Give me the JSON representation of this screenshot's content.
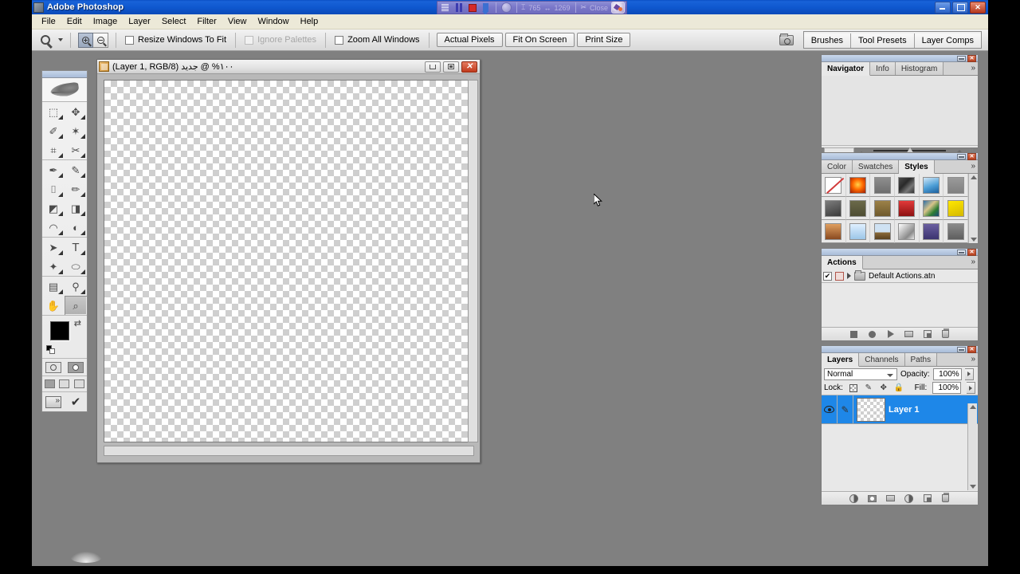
{
  "app": {
    "title": "Adobe Photoshop",
    "window_buttons": [
      {
        "name": "minimize",
        "glyph": "min"
      },
      {
        "name": "maximize",
        "glyph": "max"
      },
      {
        "name": "close",
        "glyph": "✕"
      }
    ]
  },
  "recorder": {
    "menu_icon": "menu-lines-icon",
    "pause_label": "pause",
    "stop_label": "stop",
    "save_label": "save",
    "globe_label": "globe",
    "time_value": "765",
    "size_value": "1269",
    "close_label": "Close",
    "logo_label": "recorder-logo",
    "bg_color": "#7a78c9"
  },
  "menubar": {
    "items": [
      {
        "label": "File"
      },
      {
        "label": "Edit"
      },
      {
        "label": "Image"
      },
      {
        "label": "Layer"
      },
      {
        "label": "Select"
      },
      {
        "label": "Filter"
      },
      {
        "label": "View"
      },
      {
        "label": "Window"
      },
      {
        "label": "Help"
      }
    ]
  },
  "optionsbar": {
    "tool_icon": "zoom-tool-icon",
    "zoom_in_label": "Zoom In",
    "zoom_out_label": "Zoom Out",
    "checkboxes": [
      {
        "label": "Resize Windows To Fit",
        "checked": false,
        "disabled": false
      },
      {
        "label": "Ignore Palettes",
        "checked": false,
        "disabled": true
      },
      {
        "label": "Zoom All Windows",
        "checked": false,
        "disabled": false
      }
    ],
    "buttons": [
      {
        "label": "Actual Pixels"
      },
      {
        "label": "Fit On Screen"
      },
      {
        "label": "Print Size"
      }
    ],
    "palette_well": {
      "icon": "file-browser-icon",
      "tabs": [
        {
          "label": "Brushes"
        },
        {
          "label": "Tool Presets"
        },
        {
          "label": "Layer Comps"
        }
      ]
    }
  },
  "toolbox": {
    "logo": "photoshop-feather-logo",
    "groups": [
      [
        {
          "name": "marquee-tool",
          "glyph": "⬚"
        },
        {
          "name": "move-tool",
          "glyph": "✥"
        },
        {
          "name": "lasso-tool",
          "glyph": "✑"
        },
        {
          "name": "magic-wand-tool",
          "glyph": "✶"
        },
        {
          "name": "crop-tool",
          "glyph": "⌗"
        },
        {
          "name": "slice-tool",
          "glyph": "✂"
        }
      ],
      [
        {
          "name": "healing-brush-tool",
          "glyph": "✒"
        },
        {
          "name": "brush-tool",
          "glyph": "🖌"
        },
        {
          "name": "clone-stamp-tool",
          "glyph": "⌷"
        },
        {
          "name": "history-brush-tool",
          "glyph": "✎"
        },
        {
          "name": "eraser-tool",
          "glyph": "◩"
        },
        {
          "name": "gradient-tool",
          "glyph": "◨"
        },
        {
          "name": "blur-tool",
          "glyph": "◠"
        },
        {
          "name": "dodge-tool",
          "glyph": "◐"
        }
      ],
      [
        {
          "name": "path-selection-tool",
          "glyph": "➤"
        },
        {
          "name": "type-tool",
          "glyph": "T"
        },
        {
          "name": "pen-tool",
          "glyph": "✦"
        },
        {
          "name": "ellipse-shape-tool",
          "glyph": "⬭"
        }
      ],
      [
        {
          "name": "notes-tool",
          "glyph": "▤"
        },
        {
          "name": "eyedropper-tool",
          "glyph": "⚲"
        },
        {
          "name": "hand-tool",
          "glyph": "✋"
        },
        {
          "name": "zoom-tool",
          "glyph": "⌕",
          "selected": true
        }
      ]
    ],
    "colors": {
      "foreground": "#000000",
      "background": "#ffffff",
      "swap_label": "swap-colors",
      "default_label": "default-colors"
    },
    "quick_mask": [
      {
        "name": "standard-mode",
        "active": true
      },
      {
        "name": "quick-mask-mode",
        "active": false
      }
    ],
    "screen_modes": [
      {
        "name": "standard-screen-mode",
        "active": true
      },
      {
        "name": "full-screen-menubar-mode",
        "active": false
      },
      {
        "name": "full-screen-mode",
        "active": false
      }
    ],
    "jump_to": {
      "name": "jump-to-imageready",
      "label": "ImageReady"
    }
  },
  "document": {
    "title": "١٠٠% @ جديد (Layer 1, RGB/8)",
    "zoom_percent": "١٠٠%",
    "file_name": "جديد",
    "layer_info": "(Layer 1, RGB/8)",
    "buttons": [
      {
        "name": "minimize",
        "glyph": "min"
      },
      {
        "name": "maximize",
        "glyph": "max"
      },
      {
        "name": "close",
        "glyph": "✕"
      }
    ]
  },
  "palettes": {
    "navigator": {
      "tabs": [
        {
          "label": "Navigator",
          "active": true
        },
        {
          "label": "Info",
          "active": false
        },
        {
          "label": "Histogram",
          "active": false
        }
      ],
      "menu_glyph": "»",
      "zoom_value": ""
    },
    "styles": {
      "tabs": [
        {
          "label": "Color",
          "active": false
        },
        {
          "label": "Swatches",
          "active": false
        },
        {
          "label": "Styles",
          "active": true
        }
      ],
      "menu_glyph": "»",
      "swatches": [
        {
          "name": "no-style",
          "type": "none"
        },
        {
          "name": "style-2",
          "color": "radial-gradient(circle at 50% 45%, #ffd24a 0%, #ff6a00 45%, #9c1c00 100%)"
        },
        {
          "name": "style-3",
          "color": "linear-gradient(180deg,#8e8e8e,#6e6e6e)"
        },
        {
          "name": "style-4",
          "color": "linear-gradient(135deg,#4a4a4a,#2a2a2a 40%,#777 70%,#333)"
        },
        {
          "name": "style-5",
          "color": "linear-gradient(160deg,#cfe6f7 0%,#4d9ed6 55%,#1c5f9c 100%)"
        },
        {
          "name": "style-6",
          "color": "linear-gradient(180deg,#9a9a9a,#808080)"
        },
        {
          "name": "style-7",
          "color": "linear-gradient(160deg,#7d7d7d,#3a3a3a)"
        },
        {
          "name": "style-8",
          "color": "linear-gradient(180deg,#6b6a4a,#4e4d33)"
        },
        {
          "name": "style-9",
          "color": "linear-gradient(180deg,#9c8148,#6f5a2d)"
        },
        {
          "name": "style-10",
          "color": "linear-gradient(180deg,#e23a3a,#8d1111)"
        },
        {
          "name": "style-11",
          "color": "linear-gradient(135deg,#2f6fa8 0%,#d8c48a 40%,#2e7d32 70%,#1b4a7a 100%)"
        },
        {
          "name": "style-12",
          "color": "linear-gradient(160deg,#ffe800,#d4b800)"
        },
        {
          "name": "style-13",
          "color": "linear-gradient(180deg,#e0a060,#8a4a20)"
        },
        {
          "name": "style-14",
          "color": "linear-gradient(180deg,#dfefff,#9cc6e8)"
        },
        {
          "name": "style-15",
          "color": "linear-gradient(180deg,#cfe2f3 55%,#8a6a3a 56%,#5a421f)"
        },
        {
          "name": "style-16",
          "color": "linear-gradient(135deg,#fff,#bdbdbd 40%,#8a8a8a 70%,#e8e8e8)"
        },
        {
          "name": "style-17",
          "color": "linear-gradient(180deg,#6a5fa0,#3c3470)"
        },
        {
          "name": "style-18",
          "color": "linear-gradient(180deg,#8a8a8a,#5e5e5e)"
        }
      ]
    },
    "actions": {
      "tabs": [
        {
          "label": "Actions",
          "active": true
        }
      ],
      "menu_glyph": "»",
      "rows": [
        {
          "label": "Default Actions.atn",
          "checked": "✔",
          "expanded": false
        }
      ],
      "footer_buttons": [
        {
          "name": "stop-recording-button"
        },
        {
          "name": "begin-recording-button"
        },
        {
          "name": "play-selection-button"
        },
        {
          "name": "new-set-button"
        },
        {
          "name": "new-action-button"
        },
        {
          "name": "delete-button"
        }
      ]
    },
    "layers": {
      "tabs": [
        {
          "label": "Layers",
          "active": true
        },
        {
          "label": "Channels",
          "active": false
        },
        {
          "label": "Paths",
          "active": false
        }
      ],
      "menu_glyph": "»",
      "blend_mode": "Normal",
      "opacity_label": "Opacity:",
      "opacity_value": "100%",
      "lock_label": "Lock:",
      "lock_items": [
        {
          "name": "lock-transparent-pixels"
        },
        {
          "name": "lock-image-pixels"
        },
        {
          "name": "lock-position"
        },
        {
          "name": "lock-all"
        }
      ],
      "fill_label": "Fill:",
      "fill_value": "100%",
      "rows": [
        {
          "name": "Layer 1",
          "selected": true,
          "visible": true
        }
      ],
      "footer_buttons": [
        {
          "name": "layer-style-button"
        },
        {
          "name": "layer-mask-button"
        },
        {
          "name": "new-group-button"
        },
        {
          "name": "adjustment-layer-button"
        },
        {
          "name": "new-layer-button"
        },
        {
          "name": "delete-layer-button"
        }
      ]
    }
  }
}
